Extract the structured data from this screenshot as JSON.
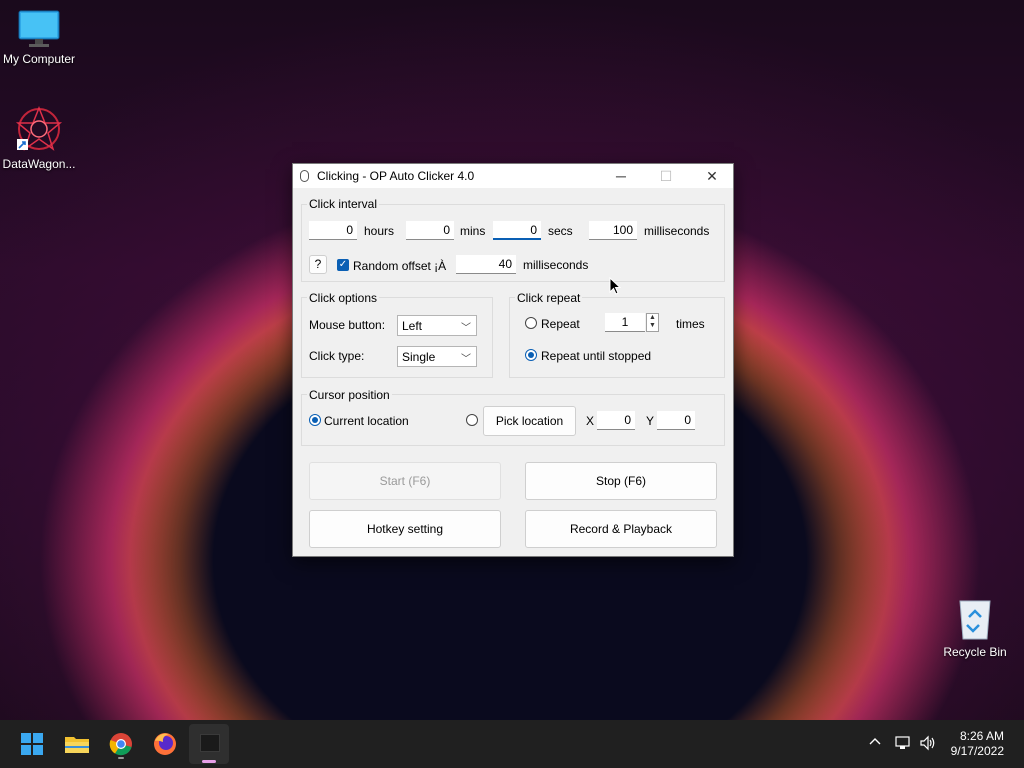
{
  "desktop": {
    "icons": [
      {
        "label": "My Computer"
      },
      {
        "label": "DataWagon..."
      },
      {
        "label": "Recycle Bin"
      }
    ]
  },
  "window": {
    "title": "Clicking - OP Auto Clicker 4.0",
    "controls": {
      "minimize": "─",
      "maximize": "☐",
      "close": "✕"
    },
    "click_interval": {
      "group_label": "Click interval",
      "hours_value": "0",
      "hours_label": "hours",
      "mins_value": "0",
      "mins_label": "mins",
      "secs_value": "0",
      "secs_label": "secs",
      "ms_value": "100",
      "ms_label": "milliseconds",
      "help_label": "?",
      "random_offset_label": "Random offset ¡À",
      "random_offset_checked": true,
      "offset_value": "40",
      "offset_label": "milliseconds"
    },
    "click_options": {
      "group_label": "Click options",
      "mouse_button_label": "Mouse button:",
      "mouse_button_value": "Left",
      "click_type_label": "Click type:",
      "click_type_value": "Single"
    },
    "click_repeat": {
      "group_label": "Click repeat",
      "repeat_label": "Repeat",
      "repeat_value": "1",
      "times_label": "times",
      "until_stopped_label": "Repeat until stopped",
      "selected": "until_stopped"
    },
    "cursor_position": {
      "group_label": "Cursor position",
      "current_location_label": "Current location",
      "pick_location_label": "Pick location",
      "x_label": "X",
      "x_value": "0",
      "y_label": "Y",
      "y_value": "0",
      "selected": "current"
    },
    "buttons": {
      "start": "Start (F6)",
      "stop": "Stop (F6)",
      "hotkey": "Hotkey setting",
      "record": "Record & Playback"
    }
  },
  "taskbar": {
    "time": "8:26 AM",
    "date": "9/17/2022",
    "tray": {
      "chevron": "^"
    }
  },
  "colors": {
    "accent": "#0a5fb4",
    "taskbar": "#202020"
  }
}
